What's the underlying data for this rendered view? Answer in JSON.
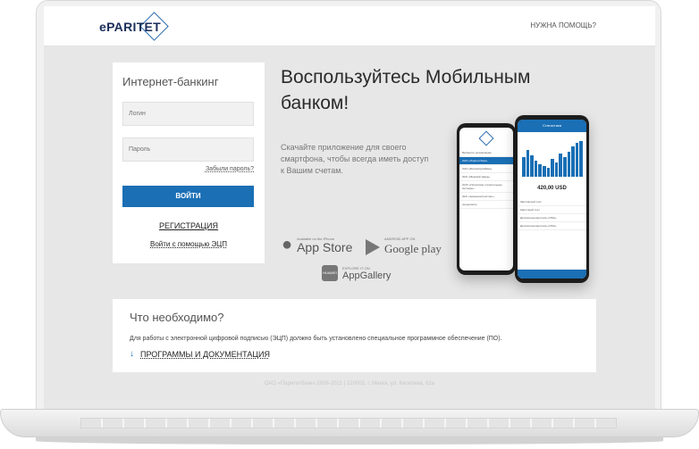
{
  "header": {
    "logo_text": "ePARITET",
    "help_label": "НУЖНА ПОМОЩЬ?"
  },
  "login": {
    "title": "Интернет-банкинг",
    "login_placeholder": "Логин",
    "password_placeholder": "Пароль",
    "forgot_label": "Забыли пароль?",
    "submit_label": "ВОЙТИ",
    "register_label": "РЕГИСТРАЦИЯ",
    "ecp_label": "Войти с помощью ЭЦП"
  },
  "promo": {
    "title": "Воспользуйтесь Мобильным банком!",
    "text": "Скачайте приложение для своего смартфона, чтобы всегда иметь доступ к Вашим счетам.",
    "stores": {
      "apple_small": "Available on the iPhone",
      "apple_big": "App Store",
      "apple_icon": "apple-icon",
      "google_small": "ANDROID APP ON",
      "google_big": "Google play",
      "google_icon": "google-play-icon",
      "huawei_small": "EXPLORE IT ON",
      "huawei_big": "AppGallery",
      "huawei_icon": "huawei-icon",
      "huawei_badge": "HUAWEI"
    }
  },
  "phone": {
    "back_header": "Выберите организацию",
    "back_items": [
      "ОАО «Паритетбанк»",
      "ОАО «Белгазпромбанк»",
      "ЗАО «Минский завод»",
      "ООО «Полесские строительные системы»",
      "ЗАО «Армеконстрастинг»"
    ],
    "back_more": "продолжить",
    "front_header": "Статистика",
    "front_amount": "420,00 USD",
    "front_items": [
      "Зарплатный счет",
      "Карточный счет",
      "Депозитная карточка «VISA»",
      "Депозитная карточка «VISA»"
    ],
    "bar_levels": [
      0.55,
      0.75,
      0.6,
      0.45,
      0.35,
      0.3,
      0.25,
      0.5,
      0.4,
      0.65,
      0.55,
      0.7,
      0.85,
      0.95,
      1.0
    ]
  },
  "info": {
    "title": "Что необходимо?",
    "text": "Для работы с электронной цифровой подписью (ЭЦП) должно быть установлено специальное программное обеспечение (ПО).",
    "docs_label": "ПРОГРАММЫ И ДОКУМЕНТАЦИЯ",
    "docs_icon": "arrow-down-icon"
  },
  "footer": {
    "text": "ОАО «Паритетбанк» 2006-2021 | 220002, г. Минск, ул. Киселева, 61а"
  },
  "colors": {
    "accent": "#1a6fb5",
    "brand_dark": "#1b2e5a",
    "background": "#e7e7e7"
  }
}
